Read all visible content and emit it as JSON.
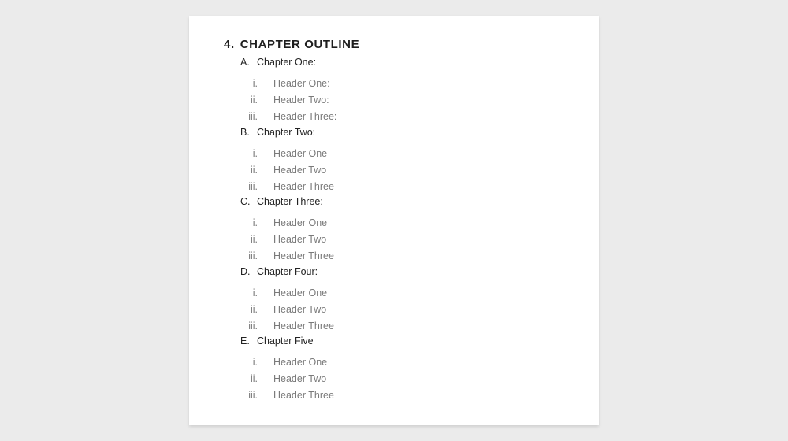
{
  "document": {
    "section_number": "4.",
    "section_title": "CHAPTER OUTLINE",
    "chapters": [
      {
        "letter": "A.",
        "title": "Chapter One:",
        "headers": [
          {
            "roman": "i.",
            "label": "Header One:"
          },
          {
            "roman": "ii.",
            "label": "Header Two:"
          },
          {
            "roman": "iii.",
            "label": "Header Three:"
          }
        ]
      },
      {
        "letter": "B.",
        "title": "Chapter Two:",
        "headers": [
          {
            "roman": "i.",
            "label": "Header One"
          },
          {
            "roman": "ii.",
            "label": "Header Two"
          },
          {
            "roman": "iii.",
            "label": "Header Three"
          }
        ]
      },
      {
        "letter": "C.",
        "title": "Chapter Three:",
        "headers": [
          {
            "roman": "i.",
            "label": "Header One"
          },
          {
            "roman": "ii.",
            "label": "Header Two"
          },
          {
            "roman": "iii.",
            "label": "Header Three"
          }
        ]
      },
      {
        "letter": "D.",
        "title": "Chapter Four:",
        "headers": [
          {
            "roman": "i.",
            "label": "Header One"
          },
          {
            "roman": "ii.",
            "label": "Header Two"
          },
          {
            "roman": "iii.",
            "label": "Header Three"
          }
        ]
      },
      {
        "letter": "E.",
        "title": "Chapter Five",
        "headers": [
          {
            "roman": "i.",
            "label": "Header One"
          },
          {
            "roman": "ii.",
            "label": "Header Two"
          },
          {
            "roman": "iii.",
            "label": "Header Three"
          }
        ]
      }
    ]
  }
}
